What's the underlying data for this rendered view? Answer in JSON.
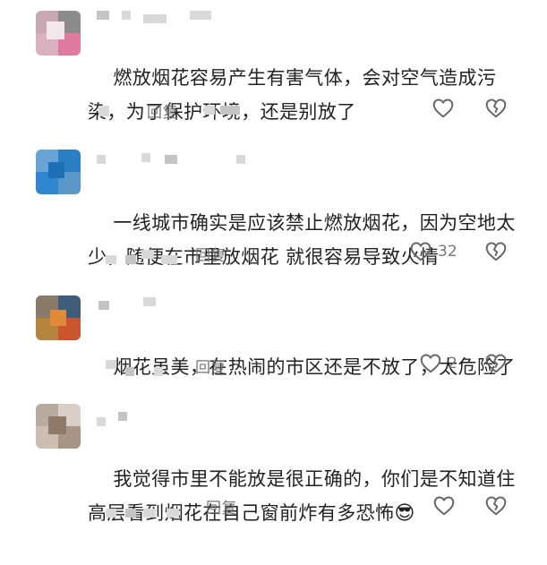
{
  "comments": [
    {
      "text": "燃放烟花容易产生有害气体，会对空气造成污染，为了保护环境，还是别放了",
      "reply_label": "回复",
      "like_count": ""
    },
    {
      "text": "一线城市确实是应该禁止燃放烟花，因为空地太少，随便在市里放烟花 就很容易导致火情",
      "reply_label": "回复",
      "like_count": "32"
    },
    {
      "text": "烟花虽美，在热闹的市区还是不放了，太危险了",
      "reply_label": "回复",
      "like_count": "2"
    },
    {
      "text": "我觉得市里不能放是很正确的，你们是不知道住高层看到烟花在自己窗前炸有多恐怖",
      "reply_label": "回复",
      "like_count": "",
      "emoji": "😎"
    }
  ],
  "colors": {
    "text": "#222222",
    "meta": "#777777",
    "icon": "#666666"
  },
  "icons": {
    "like": "heart-icon",
    "dislike": "broken-heart-icon"
  }
}
